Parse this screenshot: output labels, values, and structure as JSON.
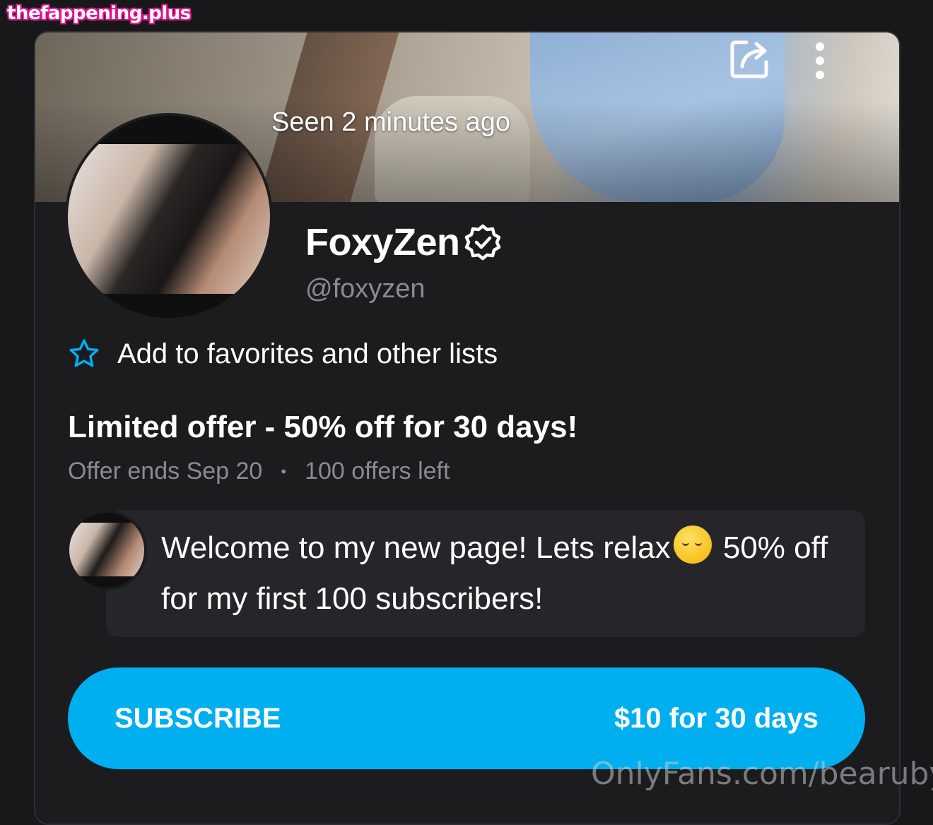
{
  "site_badge": "thefappening.plus",
  "cover": {
    "seen_text": "Seen 2 minutes ago"
  },
  "profile": {
    "display_name": "FoxyZen",
    "handle": "@foxyzen"
  },
  "favorites": {
    "label": "Add to favorites and other lists"
  },
  "offer": {
    "title": "Limited offer - 50% off for 30 days!",
    "ends": "Offer ends Sep 20",
    "separator": "•",
    "left": "100 offers left"
  },
  "message": {
    "part1": "Welcome to my new page! Lets relax",
    "part2": " 50% off for my first 100 subscribers!"
  },
  "subscribe": {
    "label": "SUBSCRIBE",
    "price": "$10 for 30 days"
  },
  "watermark": "OnlyFans.com/bearuby",
  "colors": {
    "accent": "#00aff0",
    "background": "#18181b",
    "muted_text": "#8a8a93"
  }
}
